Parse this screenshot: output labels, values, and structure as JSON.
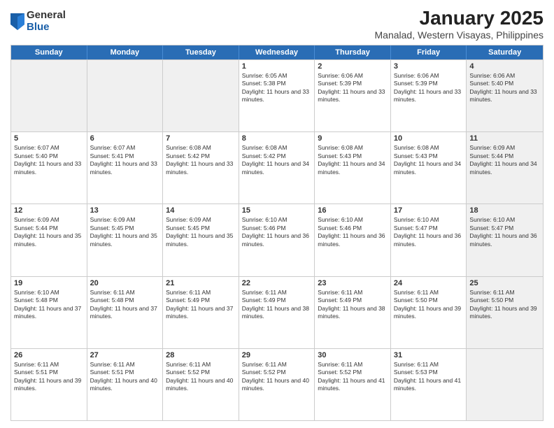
{
  "logo": {
    "general": "General",
    "blue": "Blue"
  },
  "title": "January 2025",
  "subtitle": "Manalad, Western Visayas, Philippines",
  "header_days": [
    "Sunday",
    "Monday",
    "Tuesday",
    "Wednesday",
    "Thursday",
    "Friday",
    "Saturday"
  ],
  "weeks": [
    [
      {
        "day": "",
        "text": "",
        "shaded": true,
        "empty": true
      },
      {
        "day": "",
        "text": "",
        "shaded": true,
        "empty": true
      },
      {
        "day": "",
        "text": "",
        "shaded": true,
        "empty": true
      },
      {
        "day": "1",
        "text": "Sunrise: 6:05 AM\nSunset: 5:38 PM\nDaylight: 11 hours and 33 minutes."
      },
      {
        "day": "2",
        "text": "Sunrise: 6:06 AM\nSunset: 5:39 PM\nDaylight: 11 hours and 33 minutes."
      },
      {
        "day": "3",
        "text": "Sunrise: 6:06 AM\nSunset: 5:39 PM\nDaylight: 11 hours and 33 minutes."
      },
      {
        "day": "4",
        "text": "Sunrise: 6:06 AM\nSunset: 5:40 PM\nDaylight: 11 hours and 33 minutes.",
        "shaded": true
      }
    ],
    [
      {
        "day": "5",
        "text": "Sunrise: 6:07 AM\nSunset: 5:40 PM\nDaylight: 11 hours and 33 minutes."
      },
      {
        "day": "6",
        "text": "Sunrise: 6:07 AM\nSunset: 5:41 PM\nDaylight: 11 hours and 33 minutes."
      },
      {
        "day": "7",
        "text": "Sunrise: 6:08 AM\nSunset: 5:42 PM\nDaylight: 11 hours and 33 minutes."
      },
      {
        "day": "8",
        "text": "Sunrise: 6:08 AM\nSunset: 5:42 PM\nDaylight: 11 hours and 34 minutes."
      },
      {
        "day": "9",
        "text": "Sunrise: 6:08 AM\nSunset: 5:43 PM\nDaylight: 11 hours and 34 minutes."
      },
      {
        "day": "10",
        "text": "Sunrise: 6:08 AM\nSunset: 5:43 PM\nDaylight: 11 hours and 34 minutes."
      },
      {
        "day": "11",
        "text": "Sunrise: 6:09 AM\nSunset: 5:44 PM\nDaylight: 11 hours and 34 minutes.",
        "shaded": true
      }
    ],
    [
      {
        "day": "12",
        "text": "Sunrise: 6:09 AM\nSunset: 5:44 PM\nDaylight: 11 hours and 35 minutes."
      },
      {
        "day": "13",
        "text": "Sunrise: 6:09 AM\nSunset: 5:45 PM\nDaylight: 11 hours and 35 minutes."
      },
      {
        "day": "14",
        "text": "Sunrise: 6:09 AM\nSunset: 5:45 PM\nDaylight: 11 hours and 35 minutes."
      },
      {
        "day": "15",
        "text": "Sunrise: 6:10 AM\nSunset: 5:46 PM\nDaylight: 11 hours and 36 minutes."
      },
      {
        "day": "16",
        "text": "Sunrise: 6:10 AM\nSunset: 5:46 PM\nDaylight: 11 hours and 36 minutes."
      },
      {
        "day": "17",
        "text": "Sunrise: 6:10 AM\nSunset: 5:47 PM\nDaylight: 11 hours and 36 minutes."
      },
      {
        "day": "18",
        "text": "Sunrise: 6:10 AM\nSunset: 5:47 PM\nDaylight: 11 hours and 36 minutes.",
        "shaded": true
      }
    ],
    [
      {
        "day": "19",
        "text": "Sunrise: 6:10 AM\nSunset: 5:48 PM\nDaylight: 11 hours and 37 minutes."
      },
      {
        "day": "20",
        "text": "Sunrise: 6:11 AM\nSunset: 5:48 PM\nDaylight: 11 hours and 37 minutes."
      },
      {
        "day": "21",
        "text": "Sunrise: 6:11 AM\nSunset: 5:49 PM\nDaylight: 11 hours and 37 minutes."
      },
      {
        "day": "22",
        "text": "Sunrise: 6:11 AM\nSunset: 5:49 PM\nDaylight: 11 hours and 38 minutes."
      },
      {
        "day": "23",
        "text": "Sunrise: 6:11 AM\nSunset: 5:49 PM\nDaylight: 11 hours and 38 minutes."
      },
      {
        "day": "24",
        "text": "Sunrise: 6:11 AM\nSunset: 5:50 PM\nDaylight: 11 hours and 39 minutes."
      },
      {
        "day": "25",
        "text": "Sunrise: 6:11 AM\nSunset: 5:50 PM\nDaylight: 11 hours and 39 minutes.",
        "shaded": true
      }
    ],
    [
      {
        "day": "26",
        "text": "Sunrise: 6:11 AM\nSunset: 5:51 PM\nDaylight: 11 hours and 39 minutes."
      },
      {
        "day": "27",
        "text": "Sunrise: 6:11 AM\nSunset: 5:51 PM\nDaylight: 11 hours and 40 minutes."
      },
      {
        "day": "28",
        "text": "Sunrise: 6:11 AM\nSunset: 5:52 PM\nDaylight: 11 hours and 40 minutes."
      },
      {
        "day": "29",
        "text": "Sunrise: 6:11 AM\nSunset: 5:52 PM\nDaylight: 11 hours and 40 minutes."
      },
      {
        "day": "30",
        "text": "Sunrise: 6:11 AM\nSunset: 5:52 PM\nDaylight: 11 hours and 41 minutes."
      },
      {
        "day": "31",
        "text": "Sunrise: 6:11 AM\nSunset: 5:53 PM\nDaylight: 11 hours and 41 minutes."
      },
      {
        "day": "",
        "text": "",
        "shaded": true,
        "empty": true
      }
    ]
  ]
}
